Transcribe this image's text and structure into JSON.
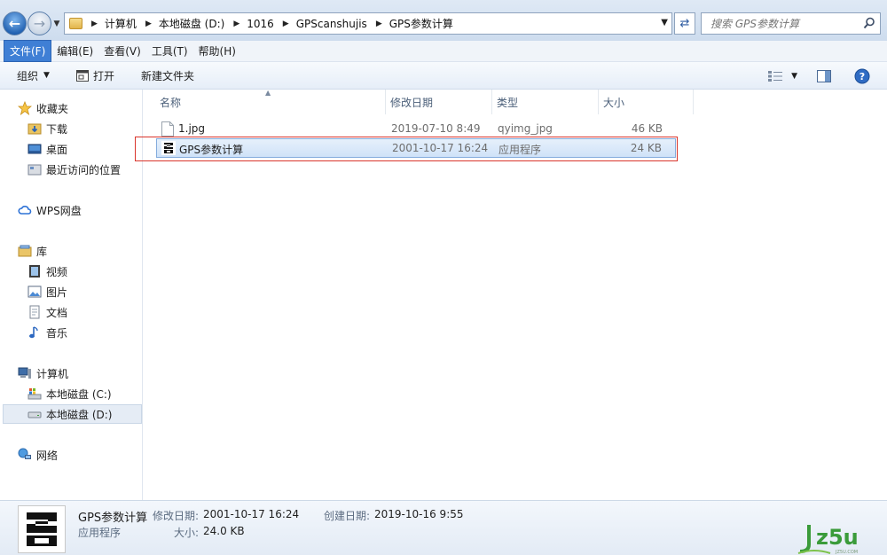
{
  "address": {
    "crumbs": [
      "计算机",
      "本地磁盘 (D:)",
      "1016",
      "GPScanshujis",
      "GPS参数计算"
    ]
  },
  "search": {
    "placeholder": "搜索 GPS参数计算"
  },
  "menu": [
    "文件(F)",
    "编辑(E)",
    "查看(V)",
    "工具(T)",
    "帮助(H)"
  ],
  "toolbar": {
    "organize": "组织",
    "open": "打开",
    "new_folder": "新建文件夹"
  },
  "nav": {
    "favorites": "收藏夹",
    "downloads": "下载",
    "desktop": "桌面",
    "recent": "最近访问的位置",
    "wps": "WPS网盘",
    "libraries": "库",
    "videos": "视频",
    "pictures": "图片",
    "documents": "文档",
    "music": "音乐",
    "computer": "计算机",
    "drive_c": "本地磁盘 (C:)",
    "drive_d": "本地磁盘 (D:)",
    "network": "网络"
  },
  "columns": {
    "name": "名称",
    "date": "修改日期",
    "type": "类型",
    "size": "大小"
  },
  "files": [
    {
      "name": "1.jpg",
      "date": "2019-07-10 8:49",
      "type": "qyimg_jpg",
      "size": "46 KB"
    },
    {
      "name": "GPS参数计算",
      "date": "2001-10-17 16:24",
      "type": "应用程序",
      "size": "24 KB"
    }
  ],
  "details": {
    "name": "GPS参数计算",
    "kind": "应用程序",
    "modified_label": "修改日期:",
    "modified": "2001-10-17 16:24",
    "created_label": "创建日期:",
    "created": "2019-10-16 9:55",
    "size_label": "大小:",
    "size": "24.0 KB"
  },
  "watermark": {
    "text": "jz5u",
    "small": "JZ5U.COM"
  },
  "colors": {
    "selection": "#cfe2f8",
    "highlight_box": "#d9342b",
    "menu_active": "#3f7fd5"
  }
}
